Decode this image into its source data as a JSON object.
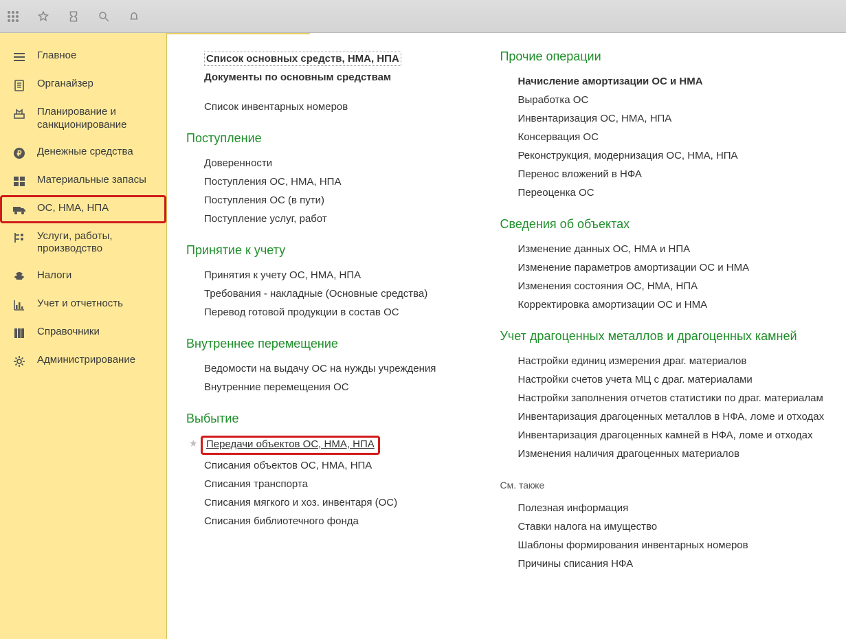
{
  "sidebar": {
    "items": [
      {
        "label": "Главное"
      },
      {
        "label": "Органайзер"
      },
      {
        "label": "Планирование и санкционирование"
      },
      {
        "label": "Денежные средства"
      },
      {
        "label": "Материальные запасы"
      },
      {
        "label": "ОС, НМА, НПА"
      },
      {
        "label": "Услуги, работы, производство"
      },
      {
        "label": "Налоги"
      },
      {
        "label": "Учет и отчетность"
      },
      {
        "label": "Справочники"
      },
      {
        "label": "Администрирование"
      }
    ]
  },
  "colA": {
    "top": {
      "items": [
        "Список основных средств, НМА, НПА",
        "Документы по основным средствам",
        "Список инвентарных номеров"
      ]
    },
    "sec1": {
      "title": "Поступление",
      "items": [
        "Доверенности",
        "Поступления ОС, НМА, НПА",
        "Поступления ОС (в пути)",
        "Поступление услуг, работ"
      ]
    },
    "sec2": {
      "title": "Принятие к учету",
      "items": [
        "Принятия к учету ОС, НМА, НПА",
        "Требования - накладные (Основные средства)",
        "Перевод готовой продукции в состав ОС"
      ]
    },
    "sec3": {
      "title": "Внутреннее перемещение",
      "items": [
        "Ведомости на выдачу ОС на нужды учреждения",
        "Внутренние перемещения ОС"
      ]
    },
    "sec4": {
      "title": "Выбытие",
      "items": [
        "Передачи объектов ОС, НМА, НПА",
        "Списания объектов ОС, НМА, НПА",
        "Списания транспорта",
        "Списания мягкого и хоз. инвентаря (ОС)",
        "Списания библиотечного фонда"
      ]
    }
  },
  "colB": {
    "sec1": {
      "title": "Прочие операции",
      "items": [
        "Начисление амортизации ОС и НМА",
        "Выработка ОС",
        "Инвентаризация ОС, НМА, НПА",
        "Консервация ОС",
        "Реконструкция, модернизация ОС, НМА, НПА",
        "Перенос вложений в НФА",
        "Переоценка ОС"
      ]
    },
    "sec2": {
      "title": "Сведения об объектах",
      "items": [
        "Изменение данных ОС, НМА и НПА",
        "Изменение параметров амортизации ОС и НМА",
        "Изменения состояния ОС, НМА, НПА",
        "Корректировка амортизации ОС и НМА"
      ]
    },
    "sec3": {
      "title": "Учет драгоценных металлов и драгоценных камней",
      "items": [
        "Настройки единиц измерения драг. материалов",
        "Настройки счетов учета МЦ с драг. материалами",
        "Настройки заполнения отчетов статистики по драг. материалам",
        "Инвентаризация драгоценных металлов в НФА, ломе и отходах",
        "Инвентаризация драгоценных камней в НФА, ломе и отходах",
        "Изменения наличия драгоценных материалов"
      ]
    },
    "seeAlso": {
      "title": "См. также",
      "items": [
        "Полезная информация",
        "Ставки налога на имущество",
        "Шаблоны формирования инвентарных номеров",
        "Причины списания НФА"
      ]
    }
  }
}
